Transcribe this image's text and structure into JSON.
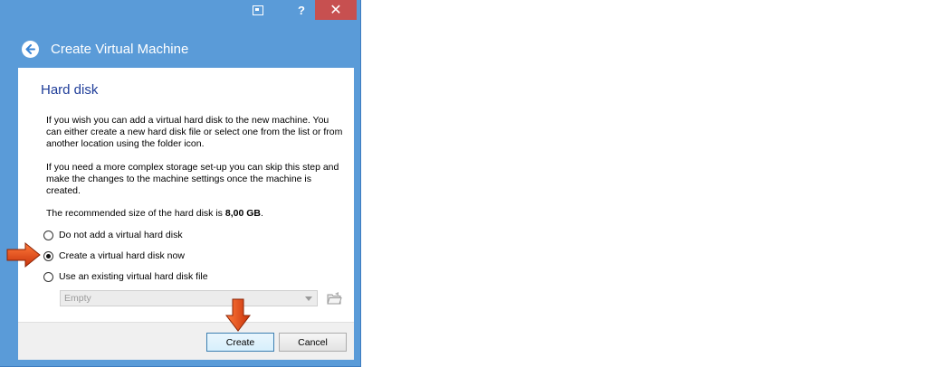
{
  "window": {
    "close_glyph": "✕",
    "help_glyph": "?"
  },
  "header": {
    "title": "Create Virtual Machine"
  },
  "section": {
    "title": "Hard disk"
  },
  "description": {
    "p1": "If you wish you can add a virtual hard disk to the new machine. You can either create a new hard disk file or select one from the list or from another location using the folder icon.",
    "p2": "If you need a more complex storage set-up you can skip this step and make the changes to the machine settings once the machine is created.",
    "p3_prefix": "The recommended size of the hard disk is ",
    "p3_value": "8,00 GB",
    "p3_suffix": "."
  },
  "options": [
    {
      "label": "Do not add a virtual hard disk",
      "checked": false
    },
    {
      "label": "Create a virtual hard disk now",
      "checked": true
    },
    {
      "label": "Use an existing virtual hard disk file",
      "checked": false
    }
  ],
  "existing_disk": {
    "selected": "Empty"
  },
  "buttons": {
    "create": "Create",
    "cancel": "Cancel"
  },
  "colors": {
    "frame": "#5a9bd8",
    "close": "#c75050",
    "title_text": "#1f3d99",
    "annotation_arrow": "#e8501e"
  },
  "icons": {
    "back": "back-arrow-icon",
    "folder": "folder-icon",
    "context": "context-menu-icon"
  }
}
